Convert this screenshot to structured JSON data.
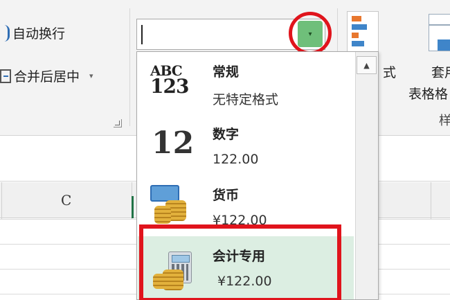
{
  "ribbon": {
    "wrap_text_label": "自动换行",
    "merge_center_label": "合并后居中",
    "merge_dropdown_glyph": "▾",
    "cond_format_label_partial": "式",
    "table_format_label_top": "套用",
    "table_format_label_bottom": "表格格",
    "styles_group_partial": "样"
  },
  "number_format_combo": {
    "value": "",
    "dropdown_glyph": "▾"
  },
  "format_list": {
    "items": [
      {
        "title": "常规",
        "sample": "无特定格式",
        "icon": "abc-123-icon",
        "icon_top": "ABC",
        "icon_bottom": "123"
      },
      {
        "title": "数字",
        "sample": "122.00",
        "icon": "number-12-icon",
        "icon_text": "12"
      },
      {
        "title": "货币",
        "sample": "¥122.00",
        "icon": "currency-icon"
      },
      {
        "title": "会计专用",
        "sample": "¥122.00",
        "icon": "accounting-icon",
        "highlighted": true
      }
    ],
    "scroll_up_glyph": "▲"
  },
  "grid": {
    "column_c": "C"
  },
  "colors": {
    "annotation_red": "#e0141c",
    "highlight_green": "#dceee2",
    "combo_button_green": "#6fbf7a",
    "ribbon_bg": "#f3f3f3"
  }
}
